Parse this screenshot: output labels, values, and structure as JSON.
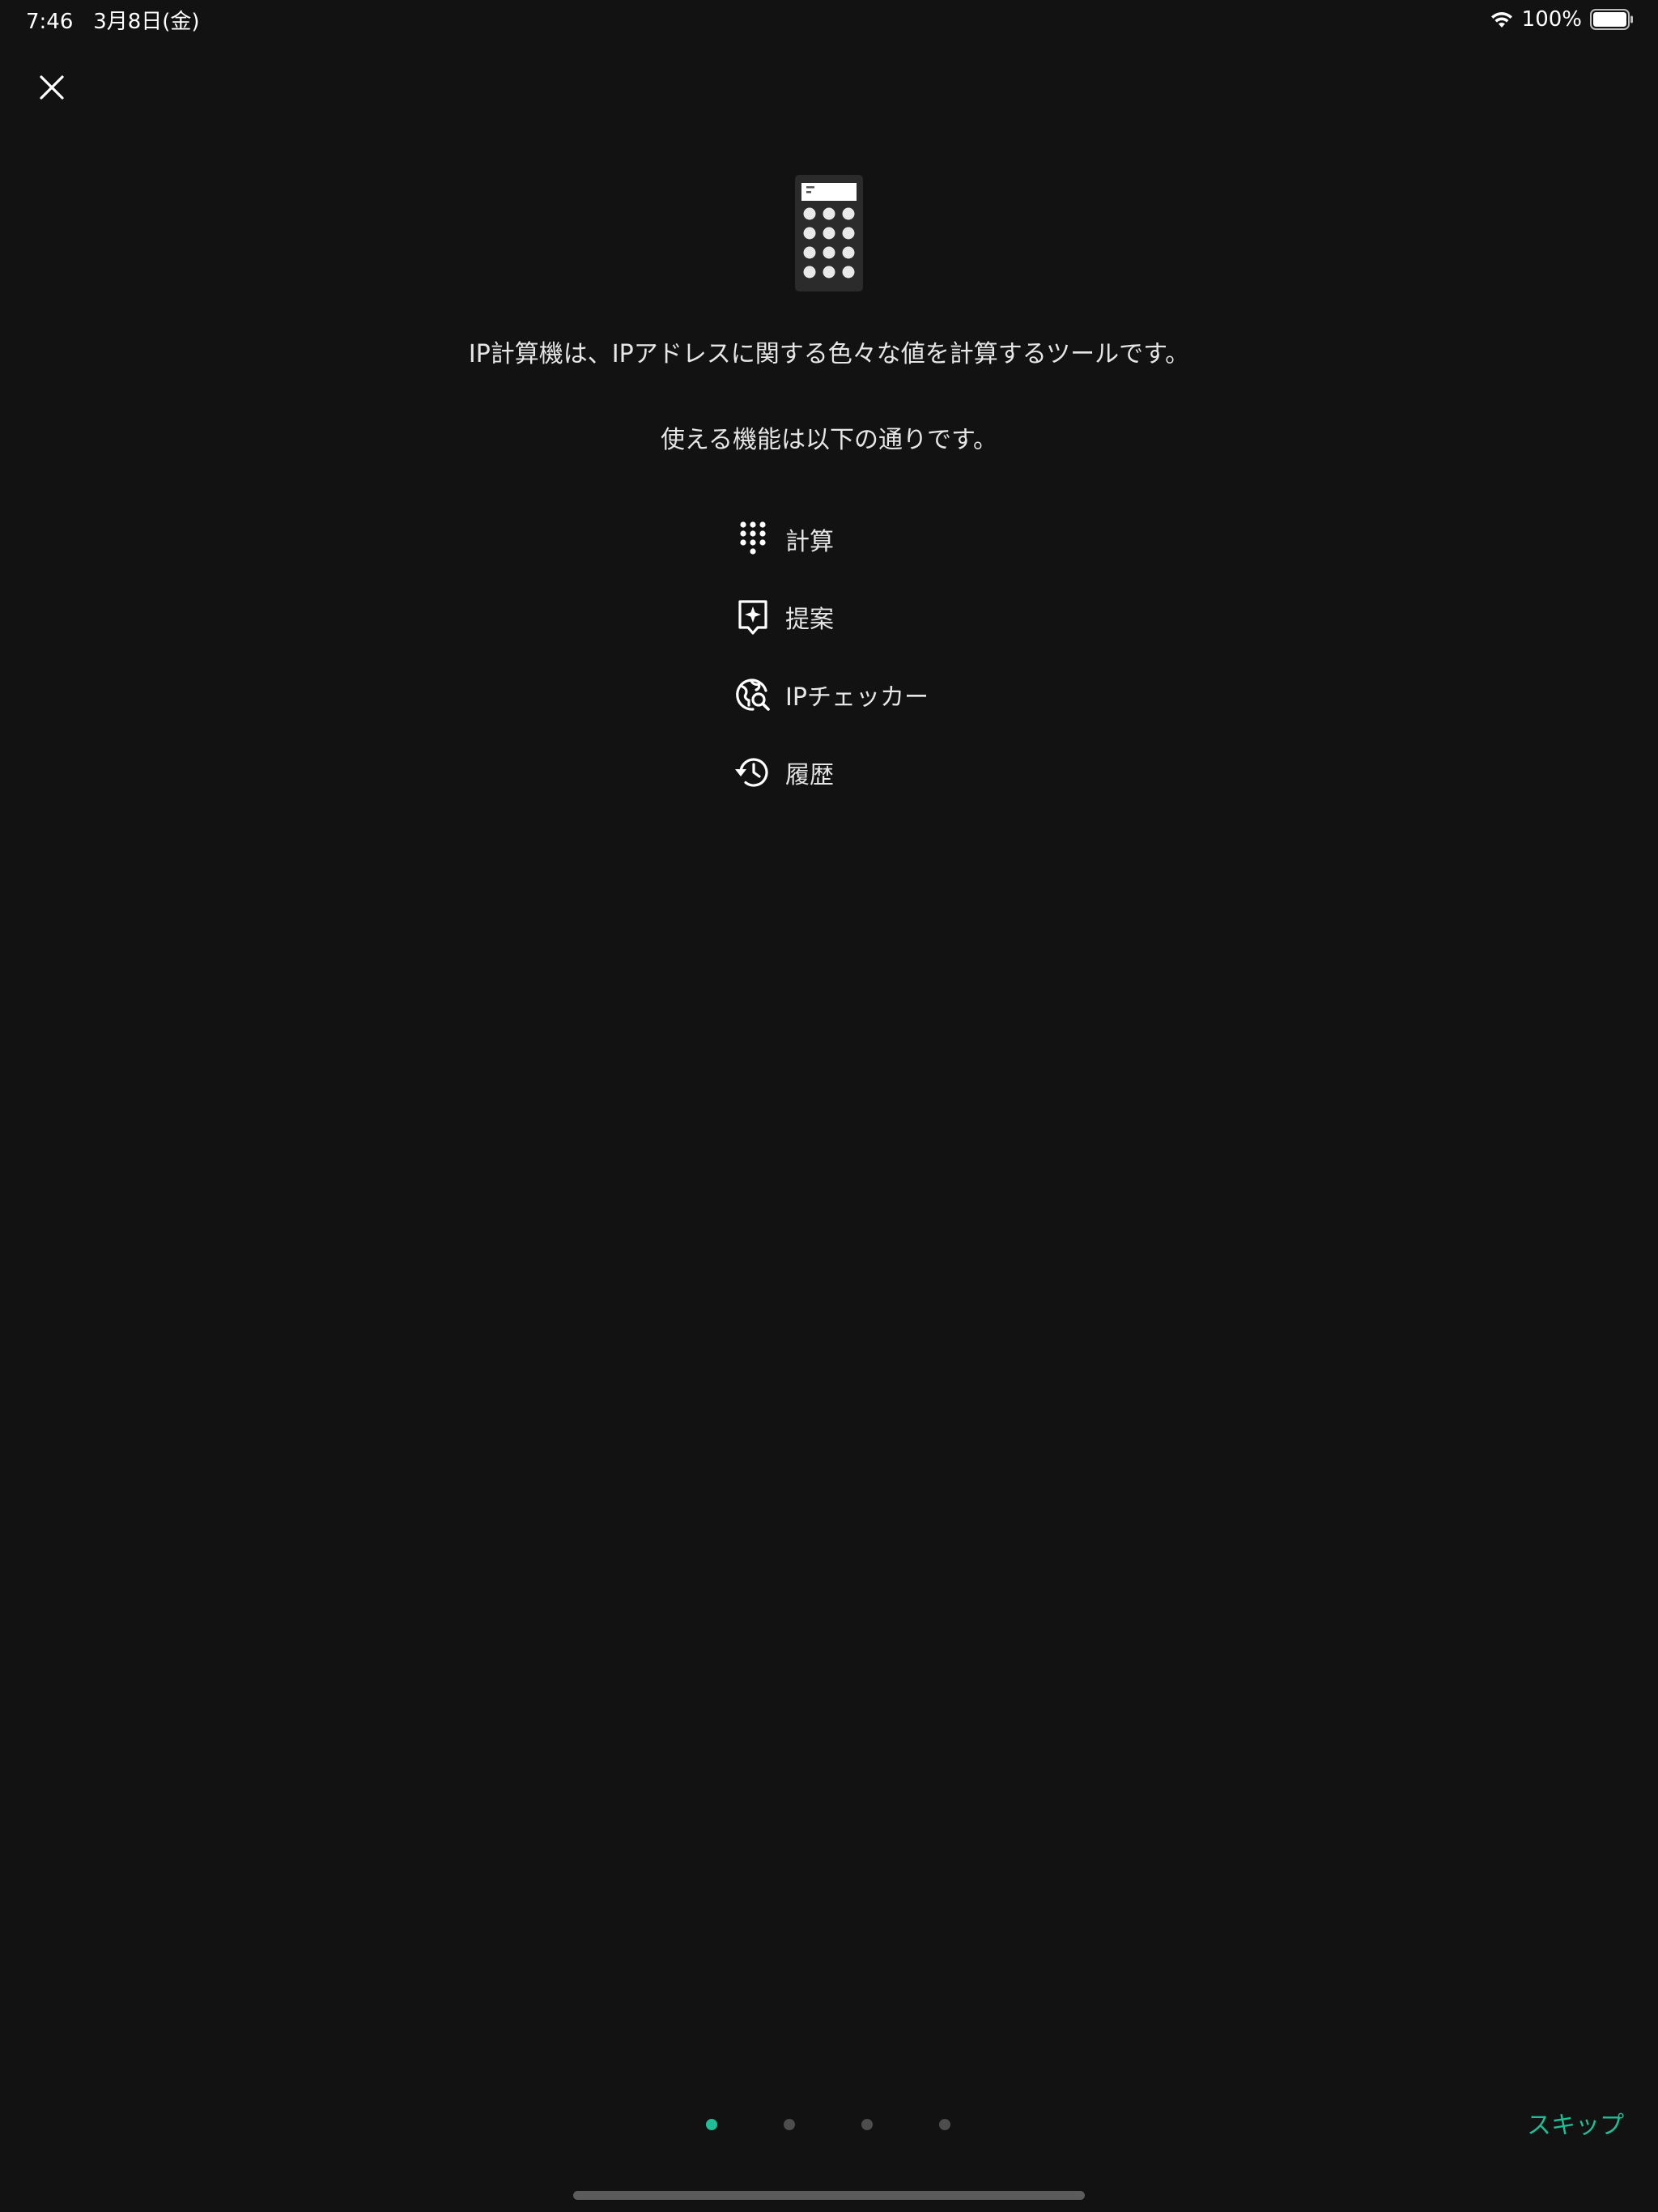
{
  "status_bar": {
    "time": "7:46",
    "date": "3月8日(金)",
    "battery_percent": "100%",
    "icons": [
      "wifi-icon",
      "battery-icon"
    ]
  },
  "header": {
    "close_icon": "close-icon"
  },
  "main": {
    "hero_icon": "calculator-icon",
    "intro": "IP計算機は、IPアドレスに関する色々な値を計算するツールです。",
    "features_intro": "使える機能は以下の通りです。",
    "features": [
      {
        "icon": "dialpad-icon",
        "label": "計算"
      },
      {
        "icon": "suggestion-icon",
        "label": "提案"
      },
      {
        "icon": "globe-search-icon",
        "label": "IPチェッカー"
      },
      {
        "icon": "history-icon",
        "label": "履歴"
      }
    ]
  },
  "footer": {
    "page_count": 4,
    "current_page": 1,
    "skip_label": "スキップ",
    "accent_color": "#1fbf95"
  }
}
